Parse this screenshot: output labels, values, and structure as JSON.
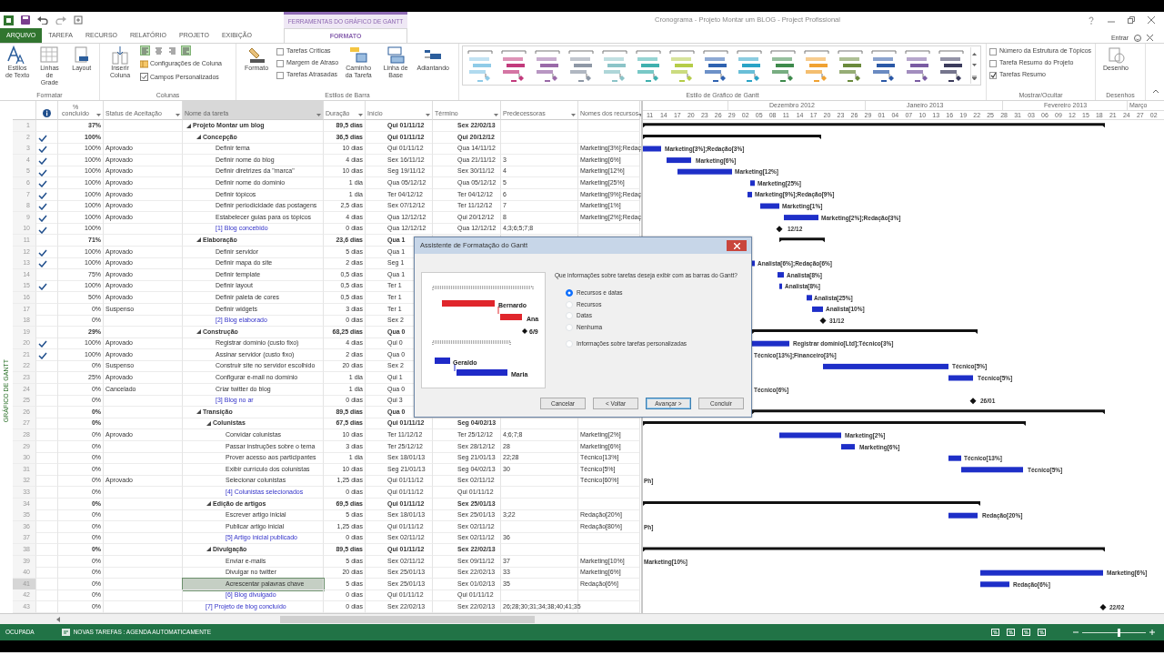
{
  "window": {
    "title": "Cronograma - Projeto Montar um BLOG - Project Profissional",
    "context_group": "FERRAMENTAS DO GRÁFICO DE GANTT",
    "account": "Entrar"
  },
  "tabs": [
    {
      "label": "ARQUIVO",
      "kind": "file",
      "selected": false
    },
    {
      "label": "TAREFA",
      "kind": "plain",
      "selected": false
    },
    {
      "label": "RECURSO",
      "kind": "plain",
      "selected": false
    },
    {
      "label": "RELATÓRIO",
      "kind": "plain",
      "selected": false
    },
    {
      "label": "PROJETO",
      "kind": "plain",
      "selected": false
    },
    {
      "label": "EXIBIÇÃO",
      "kind": "plain",
      "selected": false
    },
    {
      "label": "FORMATO",
      "kind": "context",
      "selected": true
    }
  ],
  "ribbon": [
    {
      "kind": "format",
      "label": "Formatar",
      "buttons": [
        "Estilos de Texto",
        "Linhas de Grade",
        "Layout"
      ]
    },
    {
      "kind": "columns",
      "label": "Colunas",
      "insert": "Inserir Coluna",
      "align": [
        {
          "selected": true
        },
        {
          "selected": false
        },
        {
          "selected": false
        },
        {
          "selected": true
        }
      ],
      "settings": "Configurações de Coluna",
      "custom": "Campos Personalizados"
    },
    {
      "kind": "bars",
      "label": "Estilos de Barra",
      "format": "Formato",
      "checks": [
        {
          "label": "Tarefas Críticas",
          "checked": false
        },
        {
          "label": "Margem de Atraso",
          "checked": false
        },
        {
          "label": "Tarefas Atrasadas",
          "checked": false
        }
      ],
      "buttons": [
        "Caminho da Tarefa",
        "Linha de Base",
        "Adiantando"
      ]
    },
    {
      "kind": "styles",
      "label": "Estilo de Gráfico de Gantt",
      "styles": [
        {
          "color": "#8fcbe8"
        },
        {
          "color": "#c23a7c"
        },
        {
          "color": "#9a6aa8"
        },
        {
          "color": "#8e98a6"
        },
        {
          "color": "#8cc4c8"
        },
        {
          "color": "#3fb0ae"
        },
        {
          "color": "#b5cc48"
        },
        {
          "color": "#2f62b0"
        },
        {
          "color": "#2aa3c6"
        },
        {
          "color": "#3e8a4c"
        },
        {
          "color": "#f0a232"
        },
        {
          "color": "#6a8a3c"
        },
        {
          "color": "#2b58a6"
        },
        {
          "color": "#7a5ca2"
        },
        {
          "color": "#3b3b5c"
        }
      ]
    },
    {
      "kind": "showhide",
      "label": "Mostrar/Ocultar",
      "checks": [
        {
          "label": "Número da Estrutura de Tópicos",
          "checked": false
        },
        {
          "label": "Tarefa Resumo do Projeto",
          "checked": false
        },
        {
          "label": "Tarefas Resumo",
          "checked": true
        }
      ]
    },
    {
      "kind": "drawings",
      "label": "Desenhos",
      "button": "Desenho"
    }
  ],
  "side_label": "GRÁFICO DE GANTT",
  "table": {
    "columns": [
      "% concluído",
      "Status de Aceitação",
      "Nome da tarefa",
      "Duração",
      "Início",
      "Término",
      "Predecessoras",
      "Nomes dos recursos"
    ],
    "rows": [
      {
        "id": "1",
        "kind": "summary",
        "expanded": true,
        "selected": false,
        "complete": false,
        "pct": "37%",
        "name": "Projeto Montar um blog",
        "duration": "89,5 dias",
        "start": "Qui 01/11/12",
        "finish": "Sex 22/02/13",
        "children": [
          {
            "id": "2",
            "kind": "summary",
            "expanded": true,
            "selected": false,
            "complete": true,
            "pct": "100%",
            "name": "Concepção",
            "duration": "36,5 dias",
            "start": "Qui 01/11/12",
            "finish": "Qui 20/12/12",
            "children": [
              {
                "id": "3",
                "kind": "task",
                "selected": false,
                "complete": true,
                "pct": "100%",
                "status": "Aprovado",
                "name": "Definir tema",
                "duration": "10 dias",
                "start": "Qui 01/11/12",
                "finish": "Qua 14/11/12",
                "resources": "Marketing[3%];Redaç",
                "bar_label": "Marketing[3%];Redação[3%]"
              },
              {
                "id": "4",
                "kind": "task",
                "selected": false,
                "complete": true,
                "pct": "100%",
                "status": "Aprovado",
                "name": "Definir nome do blog",
                "duration": "4 dias",
                "start": "Sex 16/11/12",
                "finish": "Qua 21/11/12",
                "predecessors": "3",
                "resources": "Marketing[6%]",
                "bar_label": "Marketing[6%]"
              },
              {
                "id": "5",
                "kind": "task",
                "selected": false,
                "complete": true,
                "pct": "100%",
                "status": "Aprovado",
                "name": "Definir diretrizes da \"marca\"",
                "duration": "10 dias",
                "start": "Seg 19/11/12",
                "finish": "Sex 30/11/12",
                "predecessors": "4",
                "resources": "Marketing[12%]",
                "bar_label": "Marketing[12%]"
              },
              {
                "id": "6",
                "kind": "task",
                "selected": false,
                "complete": true,
                "pct": "100%",
                "status": "Aprovado",
                "name": "Definir nome do domínio",
                "duration": "1 dia",
                "start": "Qua 05/12/12",
                "finish": "Qua 05/12/12",
                "predecessors": "5",
                "resources": "Marketing[25%]",
                "bar_label": "Marketing[25%]"
              },
              {
                "id": "7",
                "kind": "task",
                "selected": false,
                "complete": true,
                "pct": "100%",
                "status": "Aprovado",
                "name": "Definir tópicos",
                "duration": "1 dia",
                "start": "Ter 04/12/12",
                "finish": "Ter 04/12/12",
                "predecessors": "6",
                "resources": "Marketing[9%];Redaç",
                "bar_label": "Marketing[9%];Redação[9%]"
              },
              {
                "id": "8",
                "kind": "task",
                "selected": false,
                "complete": true,
                "pct": "100%",
                "status": "Aprovado",
                "name": "Definir periodicidade das postagens",
                "duration": "2,5 dias",
                "start": "Sex 07/12/12",
                "finish": "Ter 11/12/12",
                "predecessors": "7",
                "resources": "Marketing[1%]",
                "bar_label": "Marketing[1%]"
              },
              {
                "id": "9",
                "kind": "task",
                "selected": false,
                "complete": true,
                "pct": "100%",
                "status": "Aprovado",
                "name": "Estabelecer guias para os tópicos",
                "duration": "4 dias",
                "start": "Qua 12/12/12",
                "finish": "Qui 20/12/12",
                "predecessors": "8",
                "resources": "Marketing[2%];Redaç",
                "bar_label": "Marketing[2%];Redação[3%]"
              },
              {
                "id": "10",
                "kind": "milestone",
                "selected": false,
                "complete": true,
                "pct": "100%",
                "name": "[1] Blog concebido",
                "duration": "0 dias",
                "start": "Qua 12/12/12",
                "finish": "Qua 12/12/12",
                "predecessors": "4;3;6;5;7;8",
                "bar_label": "12/12"
              }
            ]
          },
          {
            "id": "11",
            "kind": "summary",
            "expanded": true,
            "selected": false,
            "complete": false,
            "pct": "71%",
            "name": "Elaboração",
            "duration": "23,6 dias",
            "start": "Qua 1",
            "children": [
              {
                "id": "12",
                "kind": "task",
                "selected": false,
                "complete": true,
                "pct": "100%",
                "status": "Aprovado",
                "name": "Definir servidor",
                "duration": "5 dias",
                "start": "Qua 1"
              },
              {
                "id": "13",
                "kind": "task",
                "selected": false,
                "complete": true,
                "pct": "100%",
                "status": "Aprovado",
                "name": "Definir mapa do site",
                "duration": "2 dias",
                "start": "Seg 1",
                "bar_label": "Analista[6%];Redação[6%]"
              },
              {
                "id": "14",
                "kind": "task",
                "selected": false,
                "complete": false,
                "pct": "75%",
                "status": "Aprovado",
                "name": "Definir template",
                "duration": "0,5 dias",
                "start": "Qua 1",
                "bar_label": "Analista[8%]"
              },
              {
                "id": "15",
                "kind": "task",
                "selected": false,
                "complete": true,
                "pct": "100%",
                "status": "Aprovado",
                "name": "Definir layout",
                "duration": "0,5 dias",
                "start": "Ter 1",
                "bar_label": "Analista[8%]"
              },
              {
                "id": "16",
                "kind": "task",
                "selected": false,
                "complete": false,
                "pct": "50%",
                "status": "Aprovado",
                "name": "Definir paleta de cores",
                "duration": "0,5 dias",
                "start": "Ter 1",
                "bar_label": "Analista[25%]"
              },
              {
                "id": "17",
                "kind": "task",
                "selected": false,
                "complete": false,
                "pct": "0%",
                "status": "Suspenso",
                "name": "Definir widgets",
                "duration": "3 dias",
                "start": "Ter 1",
                "bar_label": "Analista[10%]"
              },
              {
                "id": "18",
                "kind": "milestone",
                "selected": false,
                "complete": false,
                "pct": "0%",
                "name": "[2] Blog elaborado",
                "duration": "0 dias",
                "start": "Sex 2",
                "bar_label": "31/12"
              }
            ]
          },
          {
            "id": "19",
            "kind": "summary",
            "expanded": true,
            "selected": false,
            "complete": false,
            "pct": "29%",
            "name": "Construção",
            "duration": "68,25 dias",
            "start": "Qua 0",
            "children": [
              {
                "id": "20",
                "kind": "task",
                "selected": false,
                "complete": true,
                "pct": "100%",
                "status": "Aprovado",
                "name": "Registrar domínio (custo fixo)",
                "duration": "4 dias",
                "start": "Qui 0",
                "bar_label": "Registrar domínio[Ltd];Técnico[3%]"
              },
              {
                "id": "21",
                "kind": "task",
                "selected": false,
                "complete": true,
                "pct": "100%",
                "status": "Aprovado",
                "name": "Assinar servidor (custo fixo)",
                "duration": "2 dias",
                "start": "Qua 0",
                "bar_label": "Técnico[13%];Financeiro[3%]"
              },
              {
                "id": "22",
                "kind": "task",
                "selected": false,
                "complete": false,
                "pct": "0%",
                "status": "Suspenso",
                "name": "Construir site no servidor escolhido",
                "duration": "20 dias",
                "start": "Sex 2",
                "bar_label": "Técnico[5%]"
              },
              {
                "id": "23",
                "kind": "task",
                "selected": false,
                "complete": false,
                "pct": "25%",
                "status": "Aprovado",
                "name": "Configurar e-mail no domínio",
                "duration": "1 dia",
                "start": "Qui 1",
                "bar_label": "Técnico[5%]"
              },
              {
                "id": "24",
                "kind": "task",
                "selected": false,
                "complete": false,
                "pct": "0%",
                "status": "Cancelado",
                "name": "Criar twitter do blog",
                "duration": "1 dia",
                "start": "Qua 0",
                "bar_label": "Técnico[6%]"
              },
              {
                "id": "25",
                "kind": "milestone",
                "selected": false,
                "complete": false,
                "pct": "0%",
                "name": "[3] Blog no ar",
                "duration": "0 dias",
                "start": "Qui 3",
                "bar_label": "26/01"
              }
            ]
          },
          {
            "id": "26",
            "kind": "summary",
            "expanded": true,
            "selected": false,
            "complete": false,
            "pct": "0%",
            "name": "Transição",
            "duration": "89,5 dias",
            "start": "Qua 0",
            "children": [
              {
                "id": "27",
                "kind": "summary",
                "expanded": true,
                "selected": false,
                "complete": false,
                "pct": "0%",
                "name": "Colunistas",
                "duration": "67,5 dias",
                "start": "Qui 01/11/12",
                "finish": "Seg 04/02/13",
                "children": [
                  {
                    "id": "28",
                    "kind": "task",
                    "selected": false,
                    "complete": false,
                    "pct": "0%",
                    "status": "Aprovado",
                    "name": "Convidar colunistas",
                    "duration": "10 dias",
                    "start": "Ter 11/12/12",
                    "finish": "Ter 25/12/12",
                    "predecessors": "4;6;7;8",
                    "resources": "Marketing[2%]",
                    "bar_label": "Marketing[2%]"
                  },
                  {
                    "id": "29",
                    "kind": "task",
                    "selected": false,
                    "complete": false,
                    "pct": "0%",
                    "name": "Passar instruções sobre o tema",
                    "duration": "3 dias",
                    "start": "Ter 25/12/12",
                    "finish": "Sex 28/12/12",
                    "predecessors": "28",
                    "resources": "Marketing[6%]",
                    "bar_label": "Marketing[6%]"
                  },
                  {
                    "id": "30",
                    "kind": "task",
                    "selected": false,
                    "complete": false,
                    "pct": "0%",
                    "name": "Prover acesso aos participantes",
                    "duration": "1 dia",
                    "start": "Sex 18/01/13",
                    "finish": "Seg 21/01/13",
                    "predecessors": "22;28",
                    "resources": "Técnico[13%]",
                    "bar_label": "Técnico[13%]"
                  },
                  {
                    "id": "31",
                    "kind": "task",
                    "selected": false,
                    "complete": false,
                    "pct": "0%",
                    "name": "Exibir currículo dos colunistas",
                    "duration": "10 dias",
                    "start": "Seg 21/01/13",
                    "finish": "Seg 04/02/13",
                    "predecessors": "30",
                    "resources": "Técnico[5%]",
                    "bar_label": "Técnico[5%]"
                  },
                  {
                    "id": "32",
                    "kind": "task",
                    "selected": false,
                    "complete": false,
                    "pct": "0%",
                    "status": "Aprovado",
                    "name": "Selecionar colunistas",
                    "duration": "1,25 dias",
                    "start": "Qui 01/11/12",
                    "finish": "Sex 02/11/12",
                    "resources": "Técnico[60%]",
                    "bar_label": "Ph]"
                  },
                  {
                    "id": "33",
                    "kind": "milestone",
                    "selected": false,
                    "complete": false,
                    "pct": "0%",
                    "name": "[4] Colunistas selecionados",
                    "duration": "0 dias",
                    "start": "Qui 01/11/12",
                    "finish": "Qui 01/11/12"
                  }
                ]
              },
              {
                "id": "34",
                "kind": "summary",
                "expanded": true,
                "selected": false,
                "complete": false,
                "pct": "0%",
                "name": "Edição de artigos",
                "duration": "69,5 dias",
                "start": "Qui 01/11/12",
                "finish": "Sex 25/01/13",
                "children": [
                  {
                    "id": "35",
                    "kind": "task",
                    "selected": false,
                    "complete": false,
                    "pct": "0%",
                    "name": "Escrever artigo inicial",
                    "duration": "5 dias",
                    "start": "Sex 18/01/13",
                    "finish": "Sex 25/01/13",
                    "predecessors": "3;22",
                    "resources": "Redação[20%]",
                    "bar_label": "Redação[20%]"
                  },
                  {
                    "id": "36",
                    "kind": "task",
                    "selected": false,
                    "complete": false,
                    "pct": "0%",
                    "name": "Publicar artigo inicial",
                    "duration": "1,25 dias",
                    "start": "Qui 01/11/12",
                    "finish": "Sex 02/11/12",
                    "resources": "Redação[80%]",
                    "bar_label": "Ph]"
                  },
                  {
                    "id": "37",
                    "kind": "milestone",
                    "selected": false,
                    "complete": false,
                    "pct": "0%",
                    "name": "[5] Artigo inicial publicado",
                    "duration": "0 dias",
                    "start": "Sex 02/11/12",
                    "finish": "Sex 02/11/12",
                    "predecessors": "36"
                  }
                ]
              },
              {
                "id": "38",
                "kind": "summary",
                "expanded": true,
                "selected": false,
                "complete": false,
                "pct": "0%",
                "name": "Divulgação",
                "duration": "89,5 dias",
                "start": "Qui 01/11/12",
                "finish": "Sex 22/02/13",
                "children": [
                  {
                    "id": "39",
                    "kind": "task",
                    "selected": false,
                    "complete": false,
                    "pct": "0%",
                    "name": "Enviar e-mails",
                    "duration": "5 dias",
                    "start": "Sex 02/11/12",
                    "finish": "Sex 09/11/12",
                    "predecessors": "37",
                    "resources": "Marketing[10%]",
                    "bar_label": "Marketing[10%]"
                  },
                  {
                    "id": "40",
                    "kind": "task",
                    "selected": false,
                    "complete": false,
                    "pct": "0%",
                    "name": "Divulgar no twitter",
                    "duration": "20 dias",
                    "start": "Sex 25/01/13",
                    "finish": "Sex 22/02/13",
                    "predecessors": "33",
                    "resources": "Marketing[6%]",
                    "bar_label": "Marketing[6%]"
                  },
                  {
                    "id": "41",
                    "kind": "task",
                    "selected": true,
                    "complete": false,
                    "pct": "0%",
                    "name": "Acrescentar palavras chave",
                    "duration": "5 dias",
                    "start": "Sex 25/01/13",
                    "finish": "Sex 01/02/13",
                    "predecessors": "35",
                    "resources": "Redação[6%]",
                    "bar_label": "Redação[6%]"
                  },
                  {
                    "id": "42",
                    "kind": "milestone",
                    "selected": false,
                    "complete": false,
                    "pct": "0%",
                    "name": "[6] Blog divulgado",
                    "duration": "0 dias",
                    "start": "Qui 01/11/12",
                    "finish": "Qui 01/11/12"
                  }
                ]
              }
            ]
          },
          {
            "id": "43",
            "kind": "milestone",
            "selected": false,
            "complete": false,
            "pct": "0%",
            "name": "[7] Projeto de blog concluído",
            "duration": "0 dias",
            "start": "Sex 22/02/13",
            "finish": "Sex 22/02/13",
            "predecessors": "26;28;30;31;34;38;40;41;35",
            "bar_label": "22/02"
          }
        ]
      }
    ]
  },
  "timeline": {
    "months": [
      "Dezembro 2012",
      "Janeiro 2013",
      "Fevereiro 2013",
      "Março"
    ],
    "days": [
      "11",
      "14",
      "17",
      "20",
      "23",
      "26",
      "29",
      "02",
      "05",
      "08",
      "11",
      "14",
      "17",
      "20",
      "23",
      "26",
      "29",
      "01",
      "04",
      "07",
      "10",
      "13",
      "16",
      "19",
      "22",
      "25",
      "28",
      "31",
      "03",
      "06",
      "09",
      "12",
      "15",
      "18",
      "21",
      "24",
      "27",
      "02"
    ]
  },
  "dialog": {
    "title": "Assistente de Formatação do Gantt",
    "preview_labels": [
      "Bernardo",
      "Ana",
      "6/9",
      "Geraldo",
      "Maria"
    ],
    "question": "Que informações sobre tarefas deseja exibir com as barras do Gantt?",
    "options": [
      {
        "label": "Recursos e datas",
        "selected": true
      },
      {
        "label": "Recursos",
        "selected": false
      },
      {
        "label": "Datas",
        "selected": false
      },
      {
        "label": "Nenhuma",
        "selected": false
      },
      {
        "label": "Informações sobre tarefas personalizadas",
        "selected": false
      }
    ],
    "buttons": [
      {
        "label": "Cancelar",
        "default": false
      },
      {
        "label": "< Voltar",
        "default": false
      },
      {
        "label": "Avançar >",
        "default": true
      },
      {
        "label": "Concluir",
        "default": false
      }
    ]
  },
  "status_bar": {
    "mode": "OCUPADA",
    "new_tasks": "NOVAS TAREFAS : AGENDA AUTOMATICAMENTE",
    "zoom": {
      "level": 0.55
    }
  }
}
